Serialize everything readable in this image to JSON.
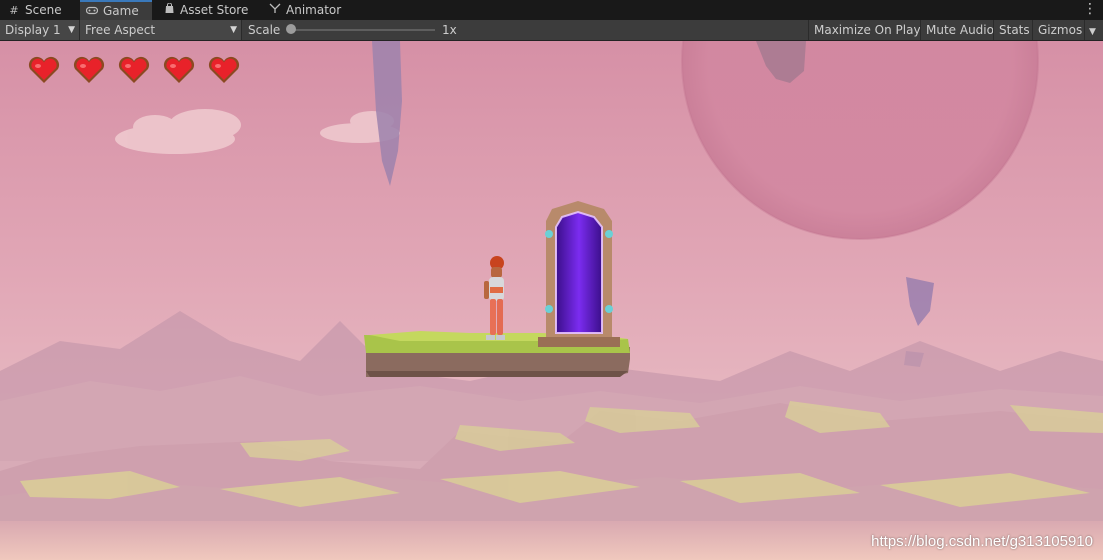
{
  "tabs": [
    {
      "label": "Scene",
      "icon": "scene-grid-icon"
    },
    {
      "label": "Game",
      "icon": "gamepad-icon",
      "active": true
    },
    {
      "label": "Asset Store",
      "icon": "asset-store-bag-icon"
    },
    {
      "label": "Animator",
      "icon": "animator-icon"
    }
  ],
  "toolbar": {
    "display": "Display 1",
    "aspect": "Free Aspect",
    "scale_label": "Scale",
    "scale_value": "1x",
    "maximize_on_play": "Maximize On Play",
    "mute_audio": "Mute Audio",
    "stats": "Stats",
    "gizmos": "Gizmos"
  },
  "game": {
    "hearts_count": 5,
    "heart_color": "#e8222a",
    "sky_color": "#dc9dae",
    "portal_color": "#7b2cf0"
  },
  "watermark": "https://blog.csdn.net/g313105910"
}
